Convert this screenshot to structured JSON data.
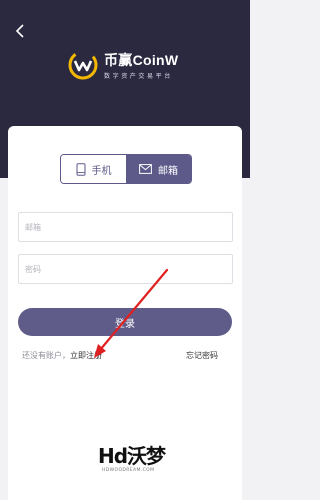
{
  "header": {
    "back_icon": "chevron-left-icon",
    "brand_name": "币赢CoinW",
    "brand_tagline": "数字资产交易平台"
  },
  "tabs": [
    {
      "label": "手机",
      "icon": "phone-icon",
      "active": false
    },
    {
      "label": "邮箱",
      "icon": "mail-icon",
      "active": true
    }
  ],
  "form": {
    "email_placeholder": "邮箱",
    "password_placeholder": "密码",
    "login_label": "登录",
    "no_account_text": "还没有账户，",
    "signup_label": "立即注册",
    "forgot_label": "忘记密码"
  },
  "watermark": {
    "text": "Hd沃梦",
    "sub": "HDWOODREAM.COM"
  },
  "colors": {
    "header_bg": "#2b2940",
    "accent": "#5d5a8a",
    "arrow": "#e02020"
  }
}
